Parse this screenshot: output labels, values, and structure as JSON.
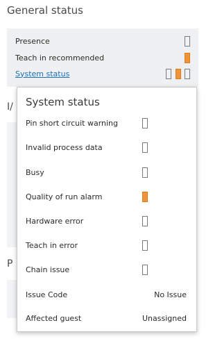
{
  "general_status": {
    "title": "General status",
    "rows": [
      {
        "label": "Presence",
        "indicators": [
          "empty"
        ]
      },
      {
        "label": "Teach in recommended",
        "indicators": [
          "orange"
        ]
      },
      {
        "label": "System status",
        "indicators": [
          "empty",
          "orange",
          "empty"
        ]
      }
    ]
  },
  "side_fragments": [
    "I/",
    "P"
  ],
  "system_status_popup": {
    "title": "System status",
    "rows": [
      {
        "label": "Pin short circuit warning",
        "indicator": "empty"
      },
      {
        "label": "Invalid process data",
        "indicator": "empty"
      },
      {
        "label": "Busy",
        "indicator": "empty"
      },
      {
        "label": "Quality of run alarm",
        "indicator": "orange"
      },
      {
        "label": "Hardware error",
        "indicator": "empty"
      },
      {
        "label": "Teach in error",
        "indicator": "empty"
      },
      {
        "label": "Chain issue",
        "indicator": "empty"
      },
      {
        "label": "Issue Code",
        "value": "No Issue"
      },
      {
        "label": "Affected guest",
        "value": "Unassigned"
      }
    ]
  },
  "colors": {
    "accent_orange": "#f0933a",
    "link_blue": "#1d6fb8",
    "panel_bg": "#eef0f1"
  }
}
